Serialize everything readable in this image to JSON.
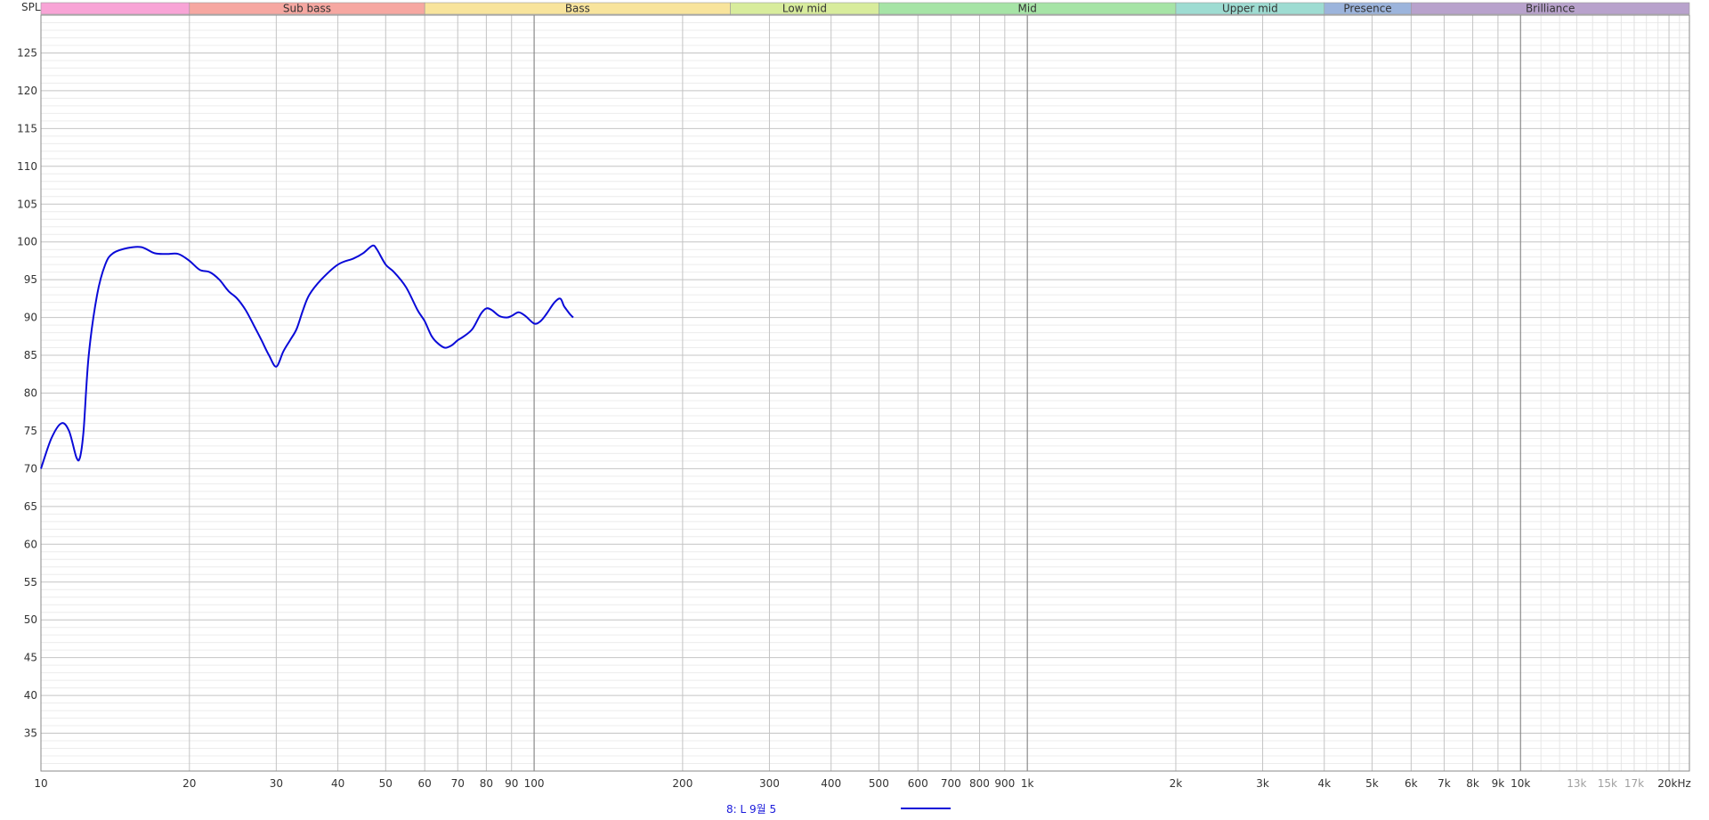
{
  "chart_data": {
    "type": "line",
    "ylabel": "SPL",
    "x_scale": "log",
    "xlim": [
      10,
      22000
    ],
    "ylim": [
      30,
      130
    ],
    "y_ticks": [
      35,
      40,
      45,
      50,
      55,
      60,
      65,
      70,
      75,
      80,
      85,
      90,
      95,
      100,
      105,
      110,
      115,
      120,
      125
    ],
    "x_tick_labels": [
      {
        "v": 10,
        "t": "10",
        "muted": false
      },
      {
        "v": 20,
        "t": "20",
        "muted": false
      },
      {
        "v": 30,
        "t": "30",
        "muted": false
      },
      {
        "v": 40,
        "t": "40",
        "muted": false
      },
      {
        "v": 50,
        "t": "50",
        "muted": false
      },
      {
        "v": 60,
        "t": "60",
        "muted": false
      },
      {
        "v": 70,
        "t": "70",
        "muted": false
      },
      {
        "v": 80,
        "t": "80",
        "muted": false
      },
      {
        "v": 90,
        "t": "90",
        "muted": false
      },
      {
        "v": 100,
        "t": "100",
        "muted": false
      },
      {
        "v": 200,
        "t": "200",
        "muted": false
      },
      {
        "v": 300,
        "t": "300",
        "muted": false
      },
      {
        "v": 400,
        "t": "400",
        "muted": false
      },
      {
        "v": 500,
        "t": "500",
        "muted": false
      },
      {
        "v": 600,
        "t": "600",
        "muted": false
      },
      {
        "v": 700,
        "t": "700",
        "muted": false
      },
      {
        "v": 800,
        "t": "800",
        "muted": false
      },
      {
        "v": 900,
        "t": "900",
        "muted": false
      },
      {
        "v": 1000,
        "t": "1k",
        "muted": false
      },
      {
        "v": 2000,
        "t": "2k",
        "muted": false
      },
      {
        "v": 3000,
        "t": "3k",
        "muted": false
      },
      {
        "v": 4000,
        "t": "4k",
        "muted": false
      },
      {
        "v": 5000,
        "t": "5k",
        "muted": false
      },
      {
        "v": 6000,
        "t": "6k",
        "muted": false
      },
      {
        "v": 7000,
        "t": "7k",
        "muted": false
      },
      {
        "v": 8000,
        "t": "8k",
        "muted": false
      },
      {
        "v": 9000,
        "t": "9k",
        "muted": false
      },
      {
        "v": 10000,
        "t": "10k",
        "muted": false
      },
      {
        "v": 13000,
        "t": "13k",
        "muted": true
      },
      {
        "v": 15000,
        "t": "15k",
        "muted": true
      },
      {
        "v": 17000,
        "t": "17k",
        "muted": true
      },
      {
        "v": 20000,
        "t": "20kHz",
        "muted": false
      }
    ],
    "bands": [
      {
        "name": "",
        "from": 10,
        "to": 20,
        "color": "#f8a4d6"
      },
      {
        "name": "Sub bass",
        "from": 20,
        "to": 60,
        "color": "#f6a7a1"
      },
      {
        "name": "Bass",
        "from": 60,
        "to": 250,
        "color": "#f8e49c"
      },
      {
        "name": "Low mid",
        "from": 250,
        "to": 500,
        "color": "#d8ec9c"
      },
      {
        "name": "Mid",
        "from": 500,
        "to": 2000,
        "color": "#a6e4a6"
      },
      {
        "name": "Upper mid",
        "from": 2000,
        "to": 4000,
        "color": "#9edcd2"
      },
      {
        "name": "Presence",
        "from": 4000,
        "to": 6000,
        "color": "#9cb4dc"
      },
      {
        "name": "Brilliance",
        "from": 6000,
        "to": 22000,
        "color": "#b8a2cc"
      }
    ],
    "series": [
      {
        "name": "8: L 9월 5",
        "color": "#0a0ad8",
        "x": [
          10,
          10.5,
          11,
          11.4,
          11.8,
          12.0,
          12.2,
          12.5,
          13,
          13.5,
          14,
          15,
          16,
          17,
          18,
          19,
          20,
          21,
          22,
          23,
          24,
          25,
          26,
          27,
          28,
          29,
          30,
          31,
          32,
          33,
          34,
          35,
          37,
          40,
          43,
          45,
          47,
          48,
          50,
          52,
          55,
          58,
          60,
          62,
          64,
          66,
          68,
          70,
          72,
          75,
          78,
          80,
          82,
          85,
          88,
          90,
          93,
          96,
          100,
          103,
          106,
          110,
          113,
          115,
          118,
          120
        ],
        "y": [
          70,
          74,
          76,
          75,
          71.5,
          71.5,
          75,
          85,
          93,
          97,
          98.5,
          99.2,
          99.3,
          98.5,
          98.4,
          98.4,
          97.5,
          96.3,
          96.0,
          95.0,
          93.5,
          92.5,
          91,
          89,
          87,
          85,
          83.5,
          85.5,
          87,
          88.5,
          91,
          93,
          95,
          97,
          97.8,
          98.5,
          99.5,
          99,
          97,
          96,
          94,
          91,
          89.5,
          87.5,
          86.5,
          86,
          86.3,
          87,
          87.5,
          88.5,
          90.5,
          91.2,
          91,
          90.2,
          90,
          90.2,
          90.7,
          90.2,
          89.2,
          89.5,
          90.5,
          92,
          92.5,
          91.5,
          90.5,
          90
        ]
      }
    ],
    "legend_position": "bottom-center"
  }
}
